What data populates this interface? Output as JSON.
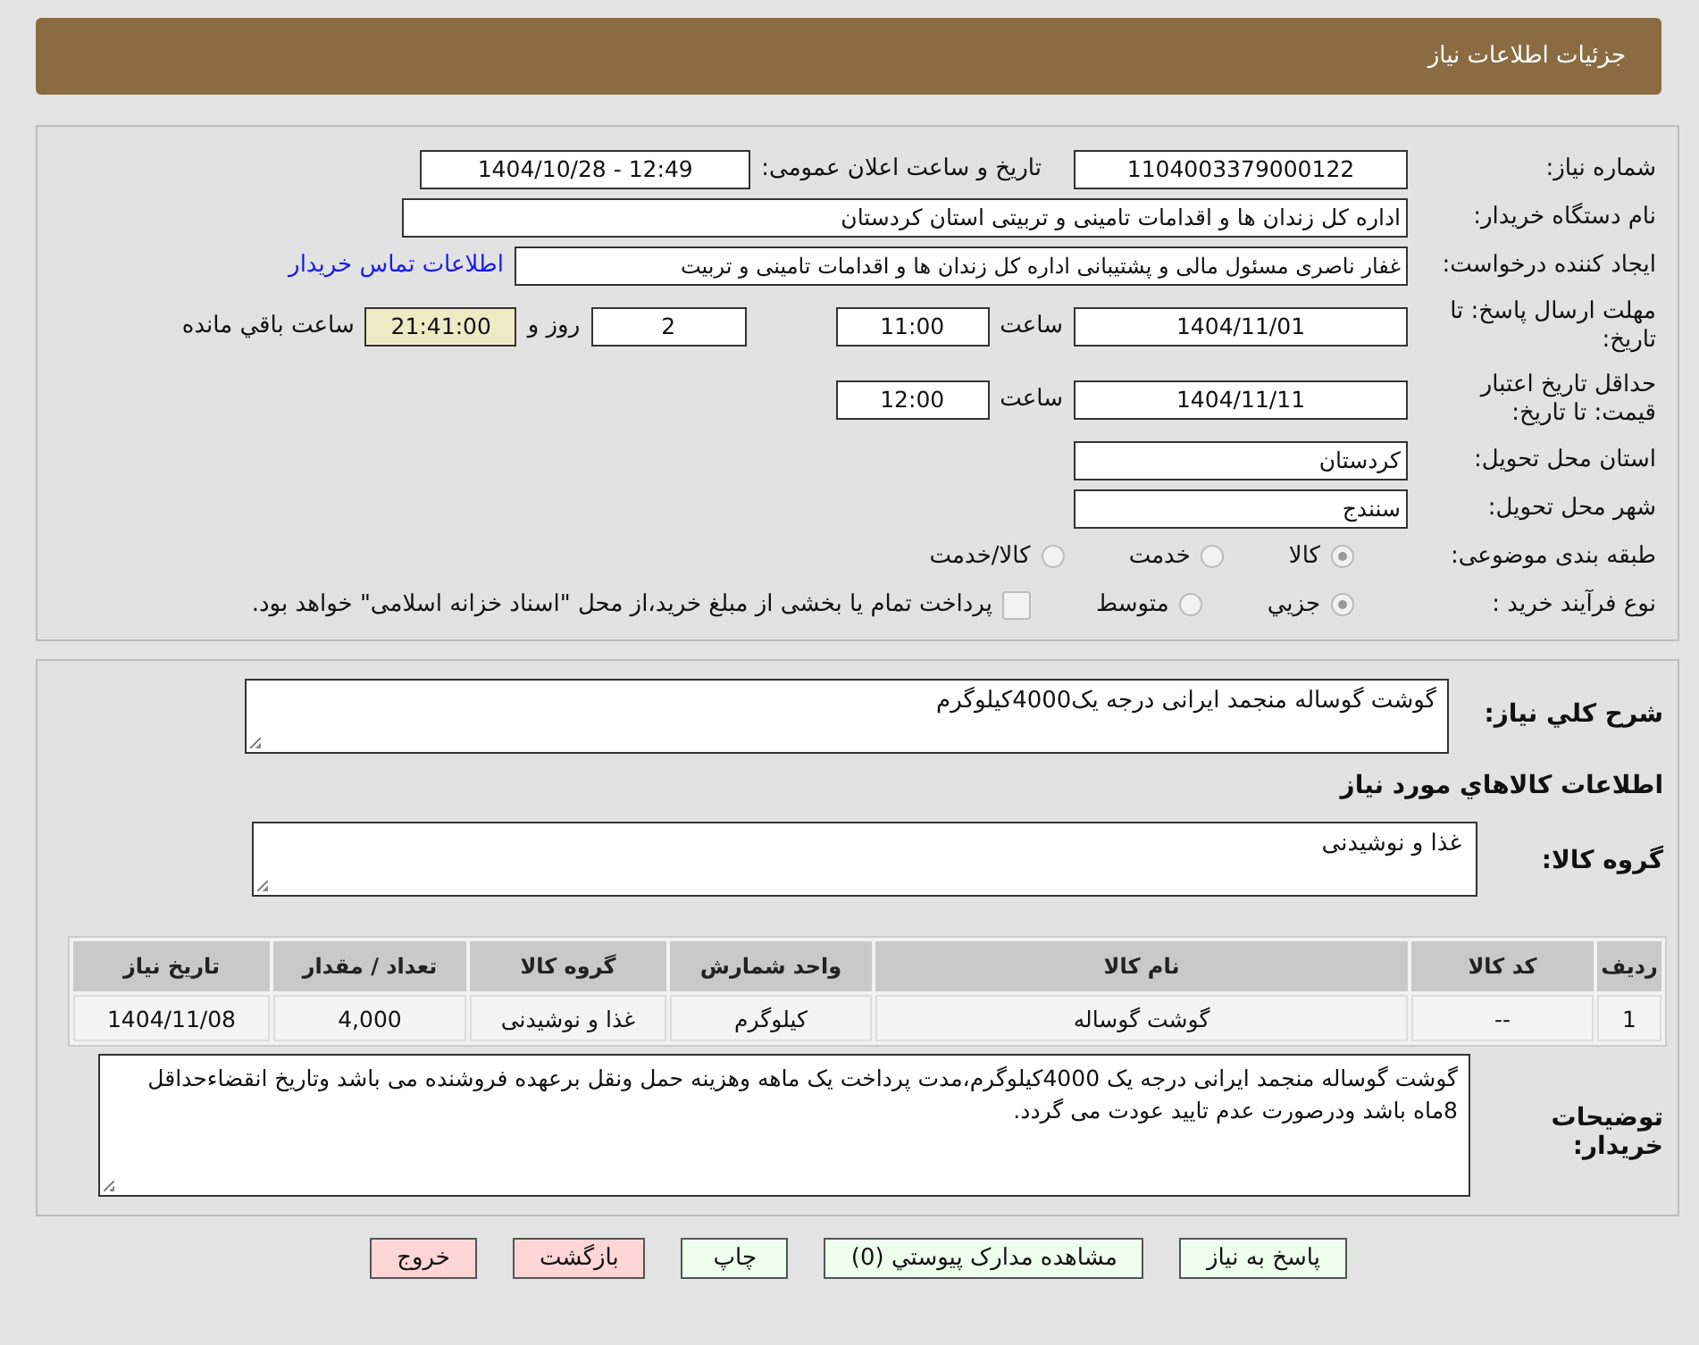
{
  "header": {
    "title": "جزئیات اطلاعات نیاز"
  },
  "need_number": {
    "label": "شماره نیاز:",
    "value": "1104003379000122"
  },
  "announce": {
    "label": "تاریخ و ساعت اعلان عمومی:",
    "value": "1404/10/28 - 12:49"
  },
  "buyer_org": {
    "label": "نام دستگاه خریدار:",
    "value": "اداره کل زندان ها و اقدامات تامینی و تربیتی استان کردستان"
  },
  "requester": {
    "label": "ایجاد کننده درخواست:",
    "value": "غفار ناصری مسئول مالی و پشتیبانی اداره کل زندان ها و اقدامات تامینی و تربیت",
    "link": "اطلاعات تماس خریدار"
  },
  "deadline": {
    "label": "مهلت ارسال پاسخ: تا تاریخ:",
    "date": "1404/11/01",
    "time_label": "ساعت",
    "time": "11:00",
    "days": "2",
    "days_label": "روز و",
    "remaining": "21:41:00",
    "remaining_label": "ساعت باقي مانده"
  },
  "validity": {
    "label": "حداقل تاریخ اعتبار قیمت: تا تاریخ:",
    "date": "1404/11/11",
    "time_label": "ساعت",
    "time": "12:00"
  },
  "province": {
    "label": "استان محل تحویل:",
    "value": "کردستان"
  },
  "city": {
    "label": "شهر محل تحویل:",
    "value": "سنندج"
  },
  "category": {
    "label": "طبقه بندی موضوعی:",
    "options": [
      {
        "label": "کالا",
        "selected": true
      },
      {
        "label": "خدمت",
        "selected": false
      },
      {
        "label": "کالا/خدمت",
        "selected": false
      }
    ]
  },
  "process": {
    "label": "نوع فرآیند خرید :",
    "options": [
      {
        "label": "جزيي",
        "selected": true
      },
      {
        "label": "متوسط",
        "selected": false
      }
    ],
    "payment_checkbox": {
      "label": "پرداخت تمام یا بخشی از مبلغ خرید،از محل \"اسناد خزانه اسلامی\" خواهد بود.",
      "checked": false
    }
  },
  "description": {
    "label": "شرح کلي نیاز:",
    "value": "گوشت گوساله منجمد ایرانی درجه یک4000کیلوگرم"
  },
  "items_heading": "اطلاعات کالاهاي مورد نیاز",
  "goods_group": {
    "label": "گروه کالا:",
    "value": "غذا و نوشیدنی"
  },
  "table": {
    "columns": [
      "ردیف",
      "کد کالا",
      "نام کالا",
      "واحد شمارش",
      "گروه کالا",
      "تعداد / مقدار",
      "تاریخ نیاز"
    ],
    "rows": [
      [
        "1",
        "--",
        "گوشت گوساله",
        "کیلوگرم",
        "غذا و نوشیدنی",
        "4,000",
        "1404/11/08"
      ]
    ]
  },
  "buyer_notes": {
    "label": "توضیحات خریدار:",
    "value": "گوشت گوساله منجمد ایرانی درجه یک 4000کیلوگرم،مدت پرداخت یک ماهه وهزینه حمل ونقل برعهده فروشنده می باشد وتاریخ انقضاءحداقل 8ماه باشد ودرصورت عدم تایید عودت می گردد."
  },
  "buttons": [
    {
      "label": "پاسخ به نیاز",
      "kind": "primary"
    },
    {
      "label": "مشاهده مدارک پیوستي (0)",
      "kind": "primary"
    },
    {
      "label": "چاپ",
      "kind": "primary"
    },
    {
      "label": "بازگشت",
      "kind": "danger"
    },
    {
      "label": "خروج",
      "kind": "danger"
    }
  ]
}
